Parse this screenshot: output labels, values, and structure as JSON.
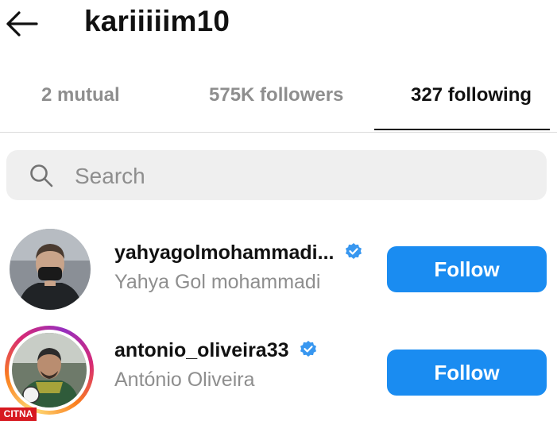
{
  "header": {
    "back_icon": "arrow-left-icon",
    "title": "kariiiiim10"
  },
  "tabs": [
    {
      "label": "2 mutual",
      "active": false
    },
    {
      "label": "575K followers",
      "active": false
    },
    {
      "label": "327 following",
      "active": true
    }
  ],
  "search": {
    "placeholder": "Search",
    "value": "",
    "icon": "search-icon"
  },
  "users": [
    {
      "username": "yahyagolmohammadi...",
      "full_name": "Yahya Gol mohammadi",
      "verified": true,
      "has_story_ring": false,
      "button_label": "Follow"
    },
    {
      "username": "antonio_oliveira33",
      "full_name": "António Oliveira",
      "verified": true,
      "has_story_ring": true,
      "button_label": "Follow"
    }
  ],
  "watermark": "CITNA",
  "colors": {
    "accent": "#1a8cf1",
    "verified": "#3897f0",
    "secondary_text": "#8e8e8e",
    "search_bg": "#efefef",
    "watermark_bg": "#d71920"
  }
}
